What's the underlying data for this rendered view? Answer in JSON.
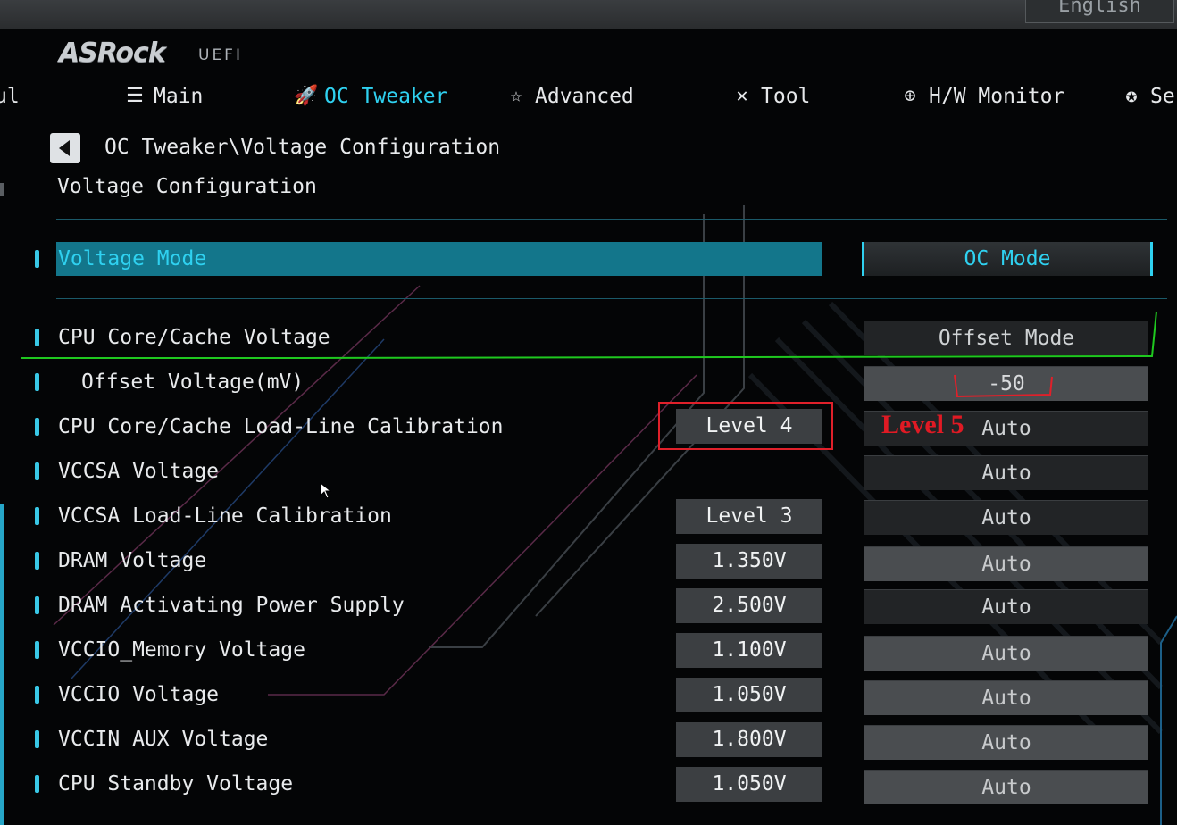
{
  "header": {
    "language_label": "English",
    "logo_text": "ASRock",
    "logo_subtext": "UEFI"
  },
  "nav": {
    "items": [
      {
        "label": "ul",
        "icon": "favorite-icon"
      },
      {
        "label": "Main",
        "icon": "list-icon"
      },
      {
        "label": "OC Tweaker",
        "icon": "rocket-icon"
      },
      {
        "label": "Advanced",
        "icon": "star-icon"
      },
      {
        "label": "Tool",
        "icon": "tools-icon"
      },
      {
        "label": "H/W Monitor",
        "icon": "crosshair-icon"
      },
      {
        "label": "Se",
        "icon": "security-badge-icon"
      }
    ],
    "active": "OC Tweaker"
  },
  "breadcrumb": "OC Tweaker\\Voltage Configuration",
  "page_title": "Voltage Configuration",
  "settings": [
    {
      "label": "Voltage Mode",
      "current": "",
      "value": "OC Mode",
      "selected": true
    },
    {
      "label": "CPU Core/Cache Voltage",
      "current": "",
      "value": "Offset Mode"
    },
    {
      "label": "Offset Voltage(mV)",
      "current": "",
      "value": "-50"
    },
    {
      "label": "CPU Core/Cache Load-Line Calibration",
      "current": "Level 4",
      "value": "Auto"
    },
    {
      "label": "VCCSA Voltage",
      "current": "",
      "value": "Auto"
    },
    {
      "label": "VCCSA Load-Line Calibration",
      "current": "Level 3",
      "value": "Auto"
    },
    {
      "label": "DRAM Voltage",
      "current": "1.350V",
      "value": "Auto"
    },
    {
      "label": "DRAM Activating Power Supply",
      "current": "2.500V",
      "value": "Auto"
    },
    {
      "label": "VCCIO_Memory Voltage",
      "current": "1.100V",
      "value": "Auto"
    },
    {
      "label": "VCCIO Voltage",
      "current": "1.050V",
      "value": "Auto"
    },
    {
      "label": "VCCIN AUX Voltage",
      "current": "1.800V",
      "value": "Auto"
    },
    {
      "label": "CPU Standby Voltage",
      "current": "1.050V",
      "value": "Auto"
    }
  ],
  "annotation": {
    "text": "Level 5",
    "color": "#e01a24"
  },
  "colors": {
    "accent": "#2fd1f0",
    "selected_row": "#13768b",
    "annotation_green": "#1fc81f"
  }
}
